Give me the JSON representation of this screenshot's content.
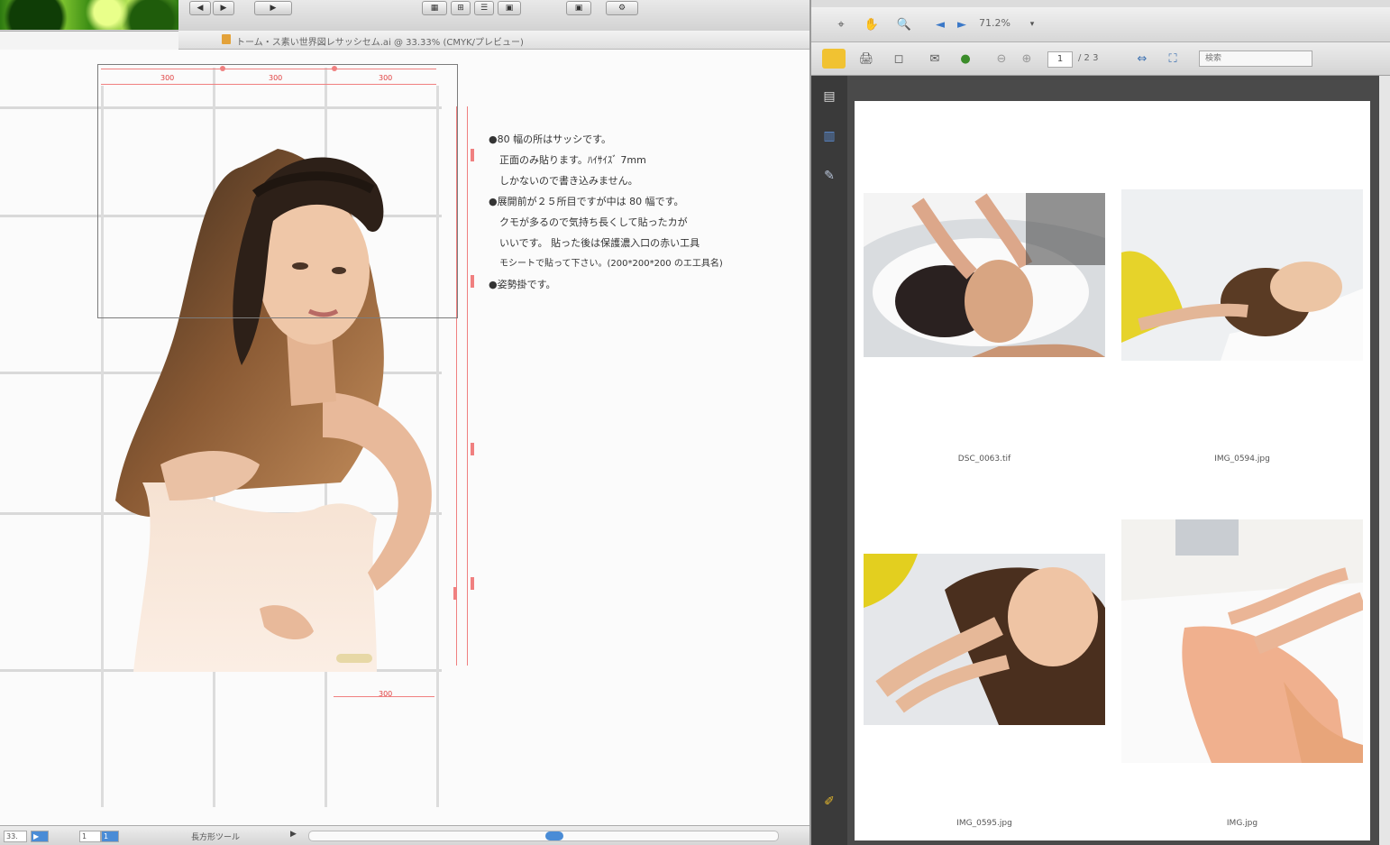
{
  "illustrator": {
    "toolbar": {
      "buttons": [
        "◀",
        "▶",
        "▦",
        "⊞",
        "☰",
        "▣",
        "⚙"
      ]
    },
    "document_title": "トーム・ス素い世界図レサッシセム.ai @ 33.33% (CMYK/プレビュー)",
    "notes": [
      "●80 幅の所はサッシです。",
      "正面のみ貼ります。ﾊｲｻｲｽﾞ 7mm",
      "しかないので書き込みません。",
      "●展開前が２５所目ですが中は 80 幅です。",
      "クモが多るので気持ち長くして貼ったカが",
      "いいです。 貼った後は保護濃入口の赤い工具",
      "モシートで貼って下さい。(200*200*200 のエ工具名)",
      "●姿勢掛です。"
    ],
    "dimension_marks": [
      "300",
      "300",
      "300",
      "300"
    ],
    "status": {
      "zoom": "33.",
      "artboard_no": "1",
      "page_nav": "1",
      "tool": "長方形ツール",
      "arrow": "▶"
    }
  },
  "acrobat": {
    "zoom_value": "71.2%",
    "page_current": "1",
    "page_total": "/ 2 3",
    "find_placeholder": "検索",
    "captions": [
      "DSC_0063.tif",
      "IMG_0594.jpg",
      "IMG_0595.jpg",
      "IMG.jpg"
    ]
  },
  "colors": {
    "accent_blue": "#4a8cd6",
    "guide_red": "#f08080",
    "dark_sidebar": "#3a3a3a"
  }
}
